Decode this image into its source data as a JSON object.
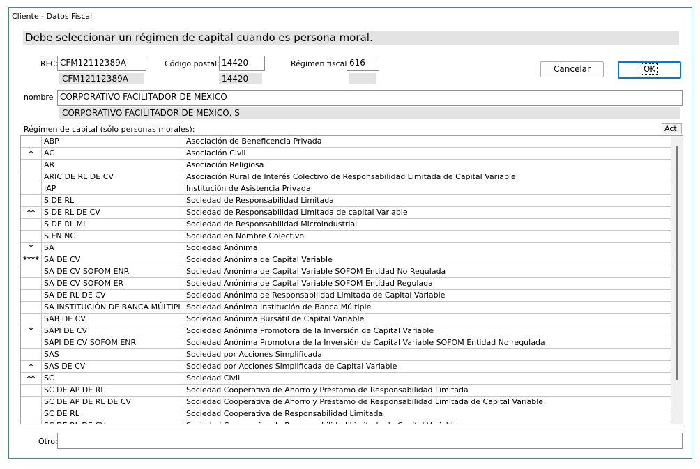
{
  "window": {
    "title": "Cliente - Datos Fiscal",
    "banner": "Debe seleccionar un régimen de capital cuando es persona moral."
  },
  "fields": {
    "rfc_label": "RFC:",
    "rfc_value": "CFM12112389A",
    "rfc_prev": "CFM12112389A",
    "cp_label": "Código postal:",
    "cp_value": "14420",
    "cp_prev": "14420",
    "regimen_label": "Régimen fiscal:",
    "regimen_value": "616",
    "regimen_prev": "",
    "nombre_label": "nombre",
    "nombre_value": "CORPORATIVO FACILITADOR DE MEXICO",
    "nombre_prev": "CORPORATIVO FACILITADOR DE MEXICO, S",
    "otro_label": "Otro:",
    "otro_value": ""
  },
  "buttons": {
    "cancel": "Cancelar",
    "ok": "OK",
    "act": "Act."
  },
  "grid": {
    "label": "Régimen de capital (sólo personas morales):",
    "rows": [
      {
        "mark": "",
        "code": "ABP",
        "desc": "Asociación de Beneficencia Privada"
      },
      {
        "mark": "*",
        "code": "AC",
        "desc": "Asociación Civil"
      },
      {
        "mark": "",
        "code": "AR",
        "desc": "Asociación Religiosa"
      },
      {
        "mark": "",
        "code": "ARIC DE RL DE CV",
        "desc": "Asociación Rural de Interés Colectivo de Responsabilidad Limitada de Capital Variable"
      },
      {
        "mark": "",
        "code": "IAP",
        "desc": "Institución de Asistencia Privada"
      },
      {
        "mark": "",
        "code": "S DE RL",
        "desc": "Sociedad de Responsabilidad Limitada"
      },
      {
        "mark": "**",
        "code": "S DE RL DE CV",
        "desc": "Sociedad de Responsabilidad Limitada de capital Variable"
      },
      {
        "mark": "",
        "code": "S DE RL MI",
        "desc": "Sociedad de Responsabilidad Microindustrial"
      },
      {
        "mark": "",
        "code": "S EN NC",
        "desc": "Sociedad en Nombre Colectivo"
      },
      {
        "mark": "*",
        "code": "SA",
        "desc": "Sociedad Anónima"
      },
      {
        "mark": "****",
        "code": "SA DE CV",
        "desc": "Sociedad Anónima de Capital Variable"
      },
      {
        "mark": "",
        "code": "SA DE CV SOFOM ENR",
        "desc": "Sociedad Anónima de Capital Variable SOFOM Entidad No Regulada"
      },
      {
        "mark": "",
        "code": "SA DE CV SOFOM ER",
        "desc": "Sociedad Anónima de Capital Variable SOFOM Entidad Regulada"
      },
      {
        "mark": "",
        "code": "SA DE RL DE CV",
        "desc": "Sociedad Anónima de Responsabilidad Limitada de Capital Variable"
      },
      {
        "mark": "",
        "code": "SA INSTITUCIÓN DE BANCA MÚLTIPLE",
        "desc": "Sociedad Anónima Institución de Banca Múltiple"
      },
      {
        "mark": "",
        "code": "SAB DE CV",
        "desc": "Sociedad Anónima Bursátil de Capital Variable"
      },
      {
        "mark": "*",
        "code": "SAPI DE CV",
        "desc": "Sociedad Anónima Promotora de la Inversión de Capital Variable"
      },
      {
        "mark": "",
        "code": "SAPI DE CV SOFOM ENR",
        "desc": "Sociedad Anónima Promotora de la Inversión de Capital Variable SOFOM Entidad No regulada"
      },
      {
        "mark": "",
        "code": "SAS",
        "desc": "Sociedad por Acciones Simplificada"
      },
      {
        "mark": "*",
        "code": "SAS DE CV",
        "desc": "Sociedad por Acciones Simplificada de Capital Variable"
      },
      {
        "mark": "**",
        "code": "SC",
        "desc": "Sociedad Civil"
      },
      {
        "mark": "",
        "code": "SC DE AP DE RL",
        "desc": "Sociedad Cooperativa de Ahorro y Préstamo de Responsabilidad Limitada"
      },
      {
        "mark": "",
        "code": "SC DE AP DE RL DE CV",
        "desc": "Sociedad Cooperativa de Ahorro y Préstamo de Responsabilidad Limitada de Capital Variable"
      },
      {
        "mark": "",
        "code": "SC DE RL",
        "desc": "Sociedad Cooperativa de Responsabilidad Limitada"
      },
      {
        "mark": "",
        "code": "SC DE RL DE CV",
        "desc": "Sociedad Cooperativa de Responsabilidad Limitada de Capital Variable"
      }
    ]
  }
}
